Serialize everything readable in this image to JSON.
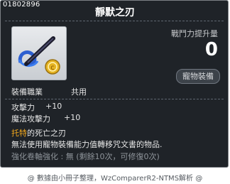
{
  "item": {
    "id": "01802896",
    "name": "靜默之刃",
    "power_label": "戰鬥力提升量",
    "power_value": "0",
    "category_badge": "寵物裝備",
    "job_label": "裝備職業",
    "job_value": "共用",
    "stats": [
      {
        "label": "攻擊力",
        "value": "+10"
      },
      {
        "label": "魔法攻擊力",
        "value": "+10"
      }
    ],
    "set_name_highlight": "托特",
    "set_name_rest": "的死亡之刃",
    "description": "無法使用寵物裝備能力值轉移咒文書的物品.",
    "enhance_text": "強化卷軸強化 : 無 (剩餘10次，可修復0次)"
  },
  "footer": {
    "text": "@ 數據由小冊子整理，WzComparerR2-NTMS解析 @"
  },
  "colors": {
    "tooltip_bg": "#1f2328",
    "text": "#e6e6e6",
    "highlight": "#f4a91c",
    "muted": "#8f959b"
  },
  "icons": {
    "item_icon": "blade-pet-equip-icon"
  }
}
